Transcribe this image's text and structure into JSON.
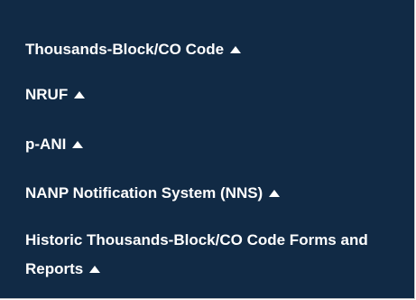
{
  "menu": {
    "items": [
      {
        "label": "Thousands-Block/CO Code",
        "icon": "caret-up-icon"
      },
      {
        "label": "NRUF",
        "icon": "caret-up-icon"
      },
      {
        "label": "p-ANI",
        "icon": "caret-up-icon"
      },
      {
        "label": "NANP Notification System (NNS)",
        "icon": "caret-up-icon"
      },
      {
        "label": "Historic Thousands-Block/CO Code Forms and Reports",
        "icon": "caret-up-icon"
      }
    ]
  },
  "colors": {
    "panel_background": "#112a45",
    "text": "#ffffff",
    "border": "#c9c9c9"
  }
}
